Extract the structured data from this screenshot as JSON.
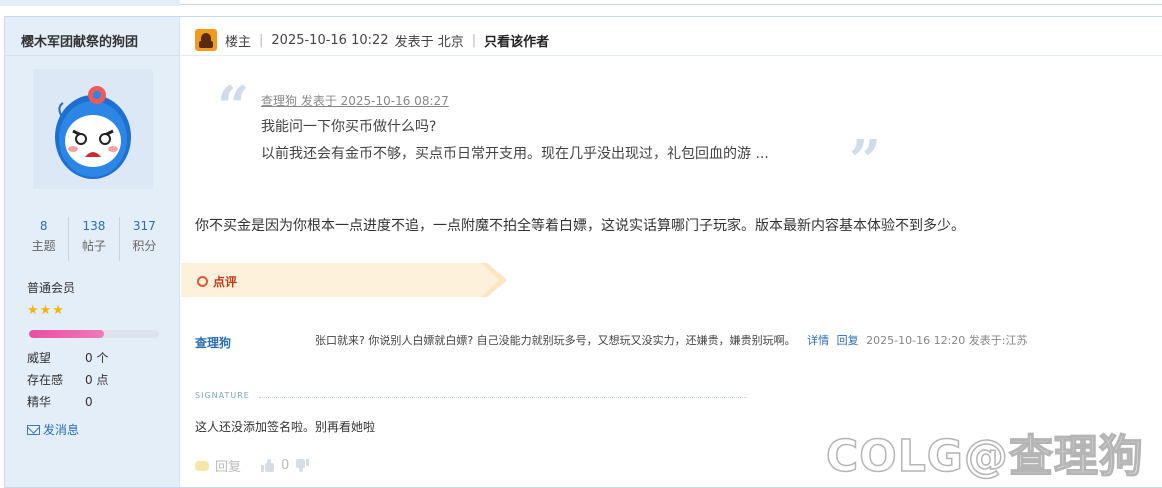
{
  "author": {
    "name": "樱木军团献祭的狗团",
    "stats": [
      {
        "value": "8",
        "label": "主题"
      },
      {
        "value": "138",
        "label": "帖子"
      },
      {
        "value": "317",
        "label": "积分"
      }
    ],
    "member_type": "普通会员",
    "stars": "★★★",
    "reputation_progress": 0.58,
    "info": [
      {
        "key": "威望",
        "value": "0 个"
      },
      {
        "key": "存在感",
        "value": "0 点"
      },
      {
        "key": "精华",
        "value": "0"
      }
    ],
    "pm_label": "发消息"
  },
  "post": {
    "role": "楼主",
    "timestamp": "2025-10-16 10:22",
    "posted_from": "发表于 北京",
    "only_author": "只看该作者",
    "quote": {
      "meta": "查理狗 发表于 2025-10-16 08:27",
      "line1": "我能问一下你买币做什么吗?",
      "line2": "以前我还会有金币不够，买点币日常开支用。现在几乎没出现过，礼包回血的游 ..."
    },
    "body": "你不买金是因为你根本一点进度不追，一点附魔不拍全等着白嫖，这说实话算哪门子玩家。版本最新内容基本体验不到多少。"
  },
  "dianping": {
    "tab_label": "点评",
    "comment": {
      "user": "查理狗",
      "text": "张口就来? 你说别人白嫖就白嫖? 自己没能力就别玩多号，又想玩又没实力，还嫌贵，嫌贵别玩啊。",
      "details": "详情",
      "reply": "回复",
      "time": "2025-10-16 12:20 发表于:江苏"
    }
  },
  "signature": {
    "label": "SIGNATURE",
    "text": "这人还没添加签名啦。别再看她啦"
  },
  "actions": {
    "reply": "回复",
    "like_count": "0"
  },
  "watermark": "COLG@查理狗",
  "colors": {
    "sidebar_bg": "#e4eef9",
    "link_blue": "#2b6db3",
    "tab_bg": "#fdf1dc",
    "accent_red": "#c13a1a",
    "progress_pink": "#e84ea0"
  }
}
